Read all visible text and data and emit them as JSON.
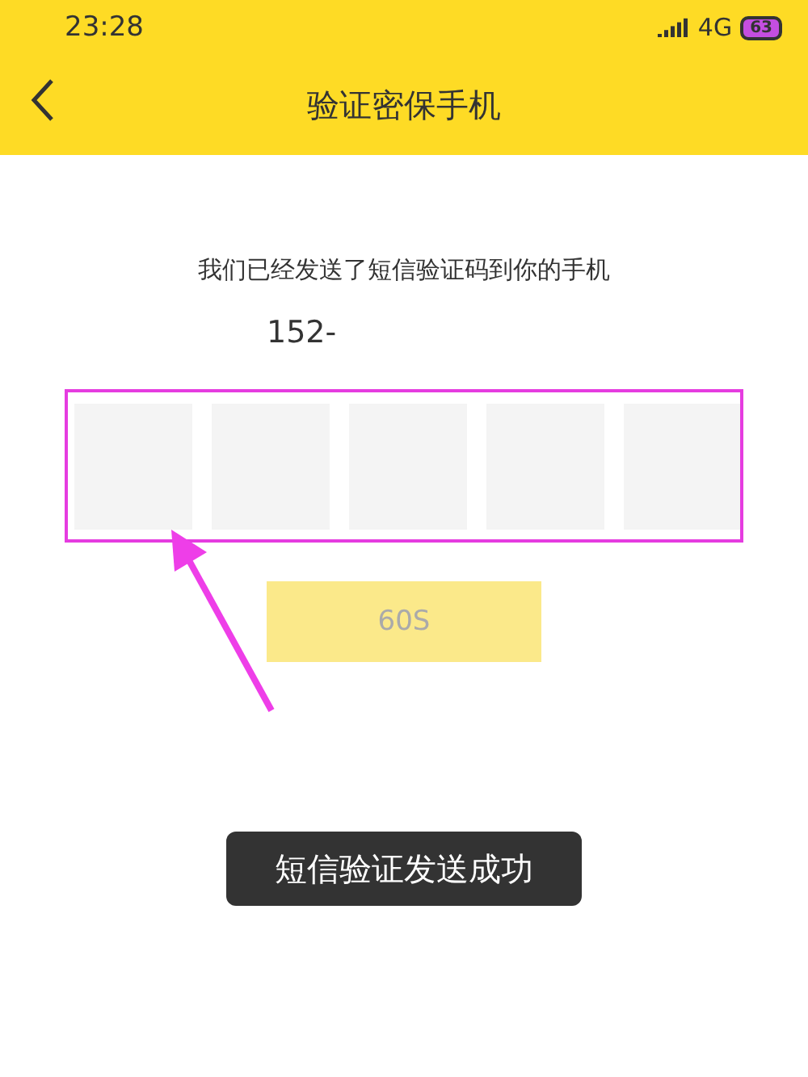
{
  "status_bar": {
    "time": "23:28",
    "network": "4G",
    "battery": "63"
  },
  "header": {
    "title": "验证密保手机"
  },
  "message": "我们已经发送了短信验证码到你的手机",
  "phone": "152-",
  "code_boxes": [
    {
      "filled": false
    },
    {
      "filled": false
    },
    {
      "filled": false
    },
    {
      "filled": false
    },
    {
      "filled": false
    }
  ],
  "resend_button": {
    "label": "60S",
    "disabled": true
  },
  "toast": "短信验证发送成功"
}
